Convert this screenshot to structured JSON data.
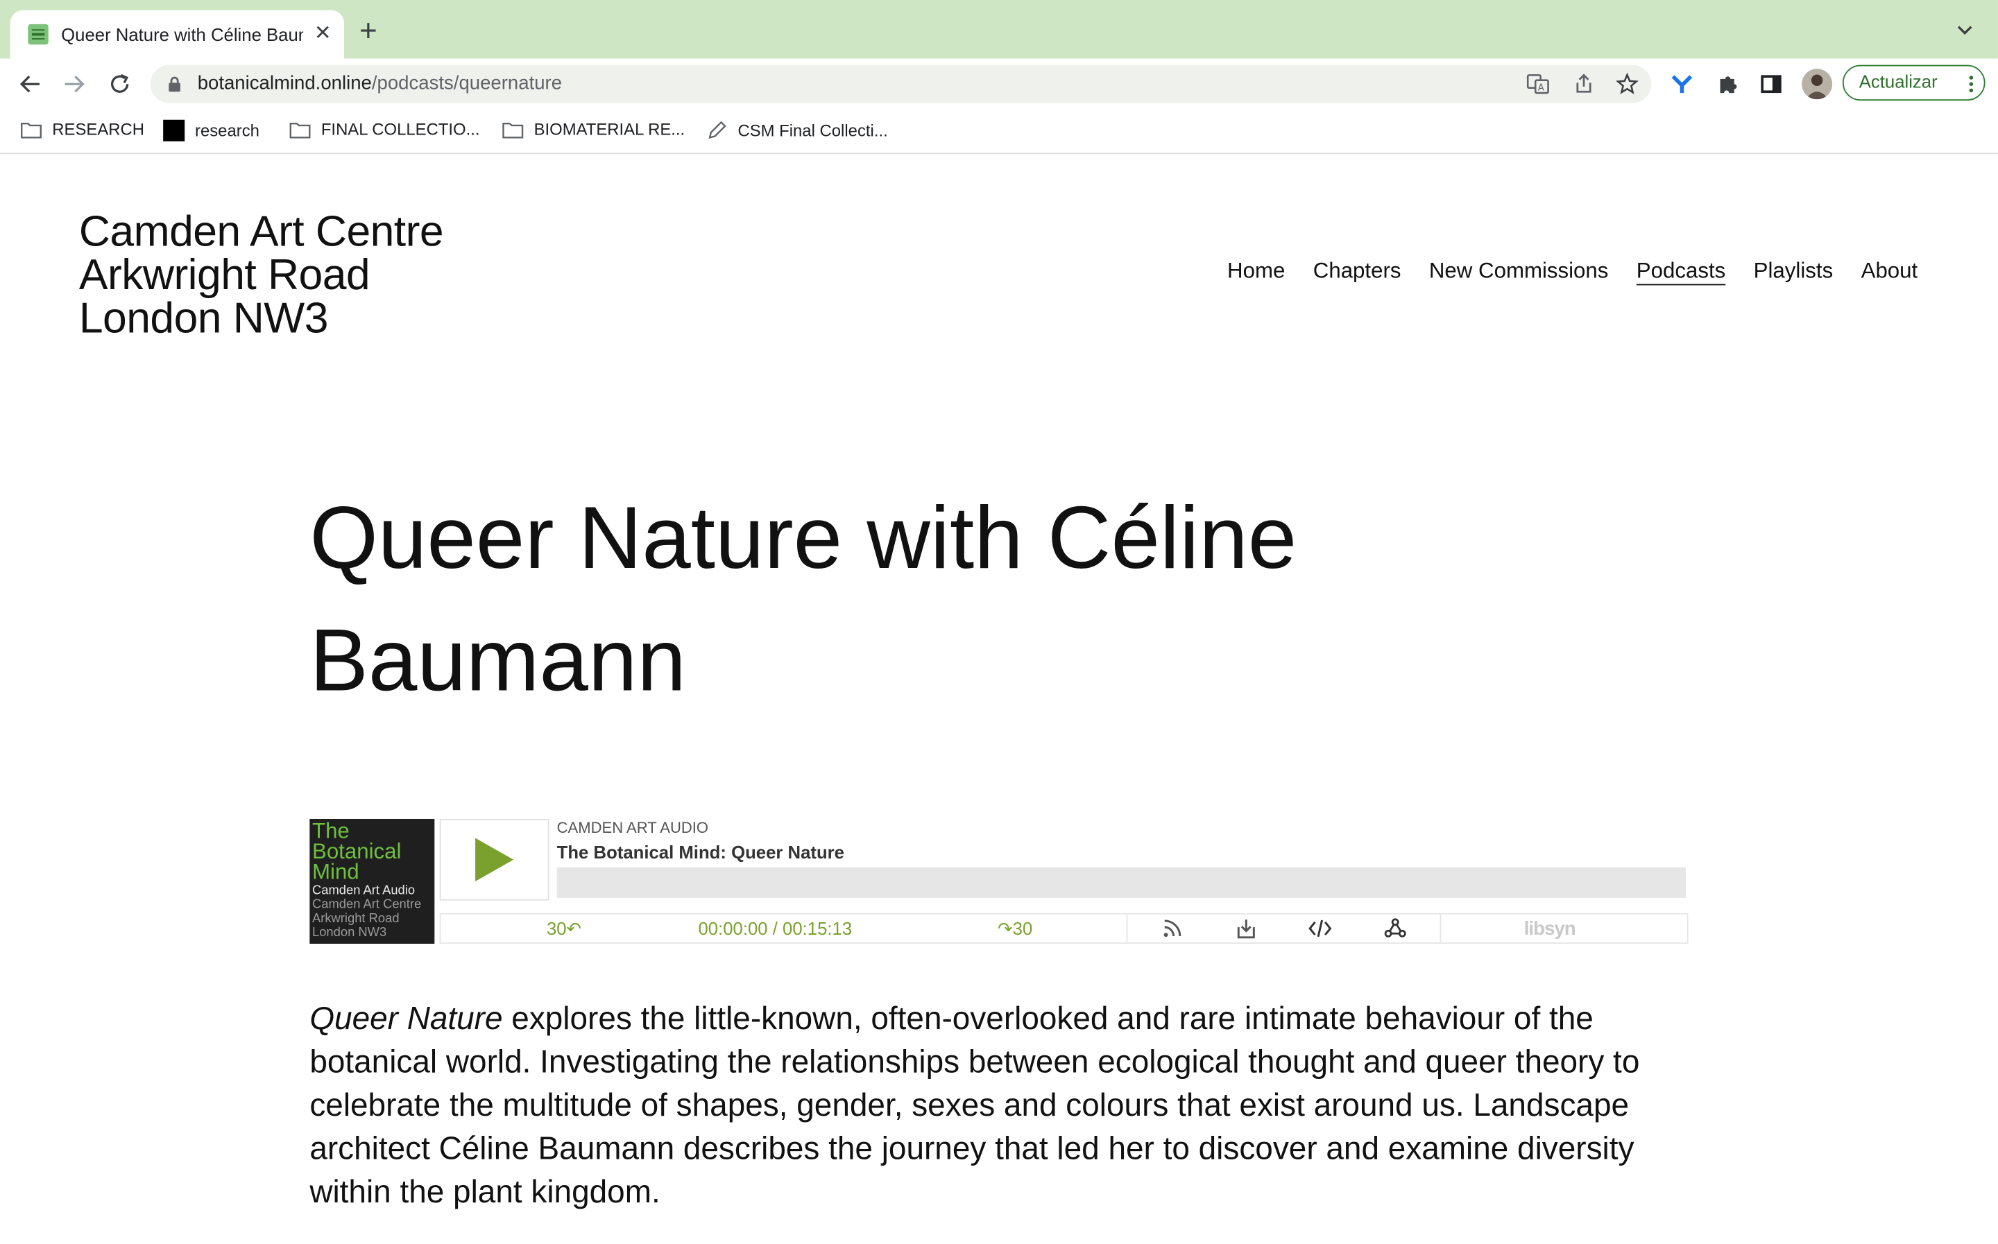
{
  "browser": {
    "tab_title": "Queer Nature with Céline Baumann",
    "url_host": "botanicalmind.online",
    "url_path": "/podcasts/queernature",
    "update_label": "Actualizar",
    "bookmarks": [
      {
        "label": "RESEARCH",
        "icon": "folder-icon"
      },
      {
        "label": "research",
        "icon": "black-square-icon"
      },
      {
        "label": "FINAL COLLECTIO...",
        "icon": "folder-icon"
      },
      {
        "label": "BIOMATERIAL RE...",
        "icon": "folder-icon"
      },
      {
        "label": "CSM Final Collecti...",
        "icon": "pencil-icon"
      }
    ]
  },
  "site": {
    "title_lines": [
      "Camden Art Centre",
      "Arkwright Road",
      "London NW3"
    ],
    "nav": [
      {
        "label": "Home",
        "active": false
      },
      {
        "label": "Chapters",
        "active": false
      },
      {
        "label": "New Commissions",
        "active": false
      },
      {
        "label": "Podcasts",
        "active": true
      },
      {
        "label": "Playlists",
        "active": false
      },
      {
        "label": "About",
        "active": false
      }
    ]
  },
  "page": {
    "heading": "Queer Nature with Céline Baumann",
    "description_italic": "Queer Nature",
    "description_rest": " explores the little-known, often-overlooked and rare intimate behaviour of the botanical world. Investigating the relationships between ecological thought and queer theory to celebrate the multitude of shapes, gender, sexes and colours that exist around us. Landscape architect Céline Baumann  describes the journey that led her to discover and examine diversity within the plant kingdom."
  },
  "player": {
    "cover_title": "The Botanical Mind",
    "cover_line1": "Camden Art Audio",
    "cover_line2": "Camden Art Centre",
    "cover_line3": "Arkwright Road",
    "cover_line4": "London NW3",
    "show_name": "CAMDEN ART AUDIO",
    "episode_title": "The Botanical Mind: Queer Nature",
    "rewind_label": "30↶",
    "forward_label": "↷30",
    "time": "00:00:00 / 00:15:13",
    "progress": 0,
    "brand": "libsyn",
    "accent": "#7aa12e"
  }
}
